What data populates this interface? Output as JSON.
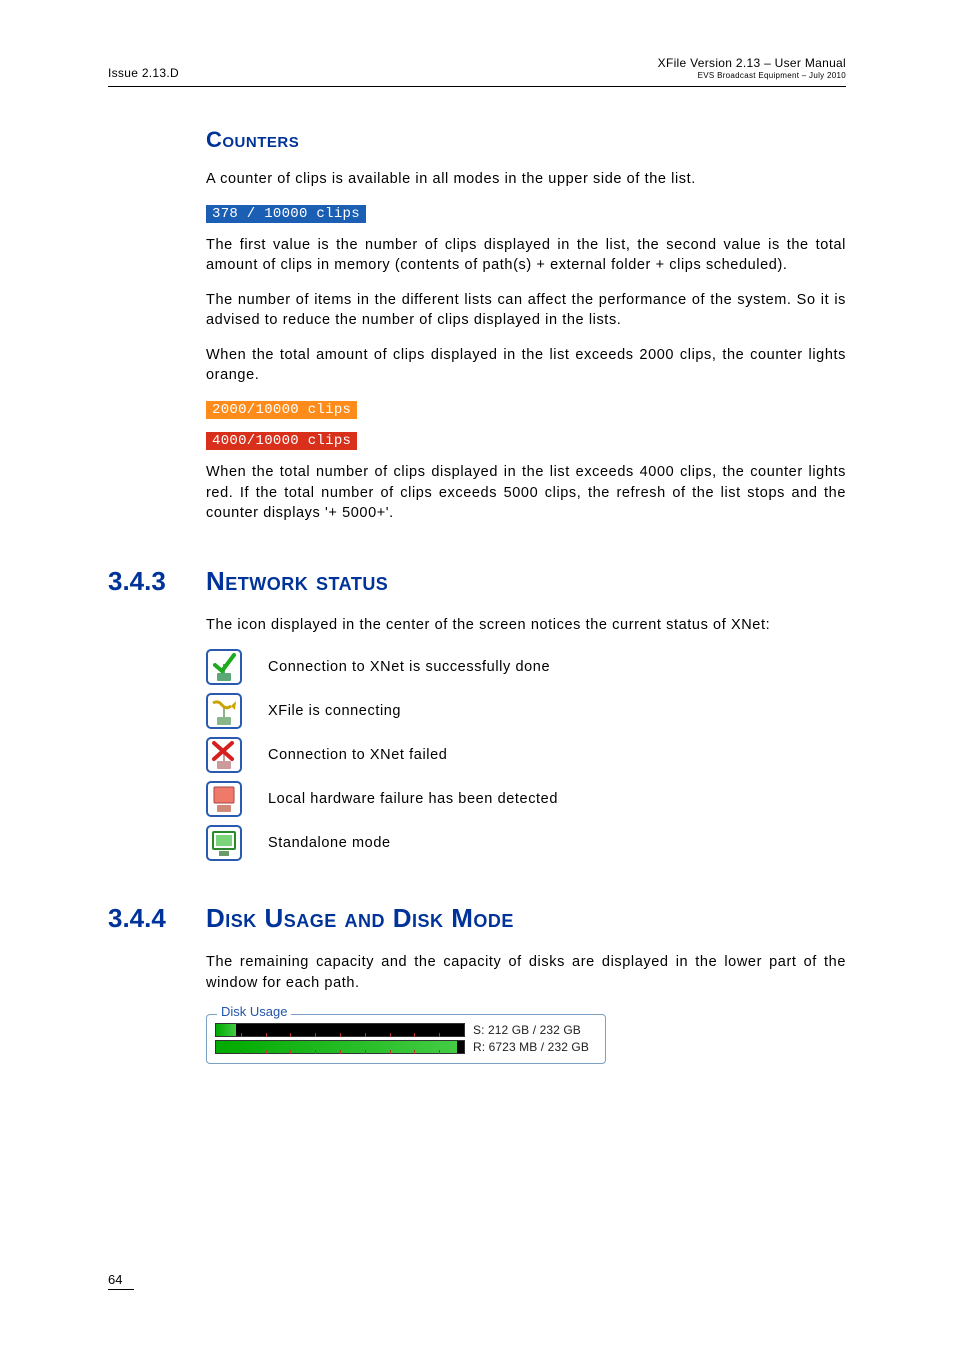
{
  "header": {
    "left": "Issue 2.13.D",
    "right_main": "XFile Version 2.13 – User Manual",
    "right_sub": "EVS Broadcast Equipment – July 2010"
  },
  "counters": {
    "title": "Counters",
    "p1": "A counter of clips is available in all modes in the upper side of the list.",
    "badge1": " 378 / 10000 clips",
    "p2": "The first value is the number of clips displayed in the list, the second value is the total amount of clips in memory (contents of path(s) + external folder + clips scheduled).",
    "p3": "The number of items in the different lists can affect the performance of the system. So it is advised to reduce the number of clips displayed in the lists.",
    "p4": "When the total amount of clips displayed in the list exceeds 2000 clips, the counter lights orange.",
    "badge2": "2000/10000 clips",
    "badge3": "4000/10000 clips",
    "p5": "When the total number of clips displayed in the list exceeds 4000 clips, the counter lights red. If the total number of clips exceeds 5000 clips, the refresh of the list stops and the counter displays '+ 5000+'."
  },
  "network": {
    "num": "3.4.3",
    "title": "Network status",
    "intro": "The icon displayed in the center of the screen notices the current status of XNet:",
    "items": [
      {
        "label": "Connection to XNet is successfully done"
      },
      {
        "label": "XFile is connecting"
      },
      {
        "label": "Connection to XNet failed"
      },
      {
        "label": "Local hardware failure has been detected"
      },
      {
        "label": "Standalone mode"
      }
    ]
  },
  "disk": {
    "num": "3.4.4",
    "title": "Disk Usage and Disk Mode",
    "intro": "The remaining capacity and the capacity of disks are displayed in the lower part of the window for each path.",
    "legend": "Disk Usage",
    "rows": [
      {
        "label": "S: 212 GB / 232 GB",
        "fill_pct": 8
      },
      {
        "label": "R: 6723 MB / 232 GB",
        "fill_pct": 97
      }
    ]
  },
  "footer": {
    "page": "64"
  }
}
